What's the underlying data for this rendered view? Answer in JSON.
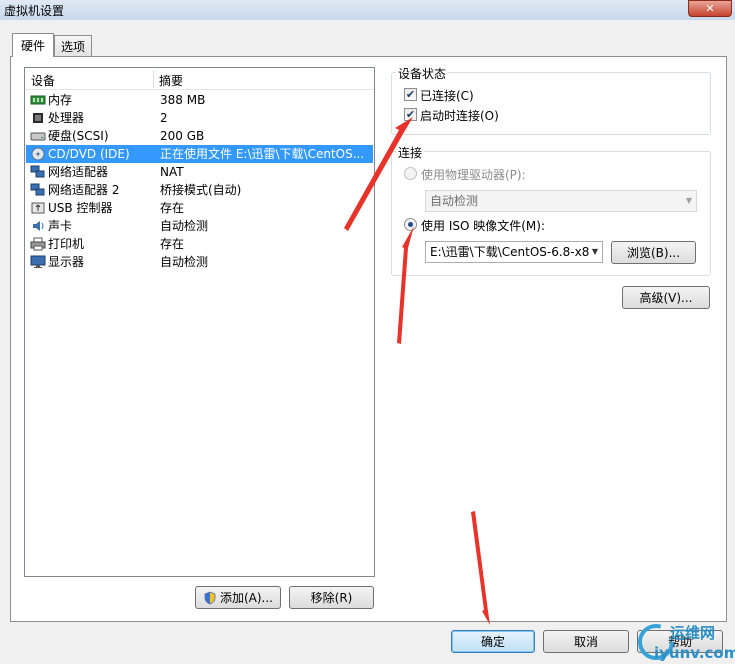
{
  "window": {
    "title": "虚拟机设置",
    "close_label": "✕"
  },
  "tabs": [
    {
      "label": "硬件"
    },
    {
      "label": "选项"
    }
  ],
  "device_list": {
    "headers": {
      "device": "设备",
      "summary": "摘要"
    },
    "rows": [
      {
        "name": "内存",
        "summary": "388 MB",
        "icon": "memory-icon"
      },
      {
        "name": "处理器",
        "summary": "2",
        "icon": "processor-icon"
      },
      {
        "name": "硬盘(SCSI)",
        "summary": "200 GB",
        "icon": "hard-disk-icon"
      },
      {
        "name": "CD/DVD (IDE)",
        "summary": "正在使用文件 E:\\迅雷\\下载\\CentOS...",
        "icon": "cd-dvd-icon",
        "selected": true
      },
      {
        "name": "网络适配器",
        "summary": "NAT",
        "icon": "network-adapter-icon"
      },
      {
        "name": "网络适配器 2",
        "summary": "桥接模式(自动)",
        "icon": "network-adapter-icon"
      },
      {
        "name": "USB 控制器",
        "summary": "存在",
        "icon": "usb-icon"
      },
      {
        "name": "声卡",
        "summary": "自动检测",
        "icon": "sound-card-icon"
      },
      {
        "name": "打印机",
        "summary": "存在",
        "icon": "printer-icon"
      },
      {
        "name": "显示器",
        "summary": "自动检测",
        "icon": "display-icon"
      }
    ]
  },
  "list_buttons": {
    "add": "添加(A)...",
    "remove": "移除(R)"
  },
  "device_status": {
    "title": "设备状态",
    "connected": {
      "label": "已连接(C)",
      "checked": true
    },
    "connect_at_power_on": {
      "label": "启动时连接(O)",
      "checked": true
    }
  },
  "connection": {
    "title": "连接",
    "physical_drive": {
      "label": "使用物理驱动器(P):",
      "selected": false,
      "enabled": false
    },
    "physical_drive_select": "自动检测",
    "iso_image": {
      "label": "使用 ISO 映像文件(M):",
      "selected": true
    },
    "iso_path": "E:\\迅雷\\下载\\CentOS-6.8-x8",
    "browse": "浏览(B)..."
  },
  "advanced_button": "高级(V)...",
  "footer": {
    "ok": "确定",
    "cancel": "取消",
    "help": "帮助"
  },
  "watermark": {
    "text": "运维网",
    "url": "iyunv.com"
  },
  "colors": {
    "selection": "#3399ff",
    "annotation_arrow": "#e8332a"
  }
}
